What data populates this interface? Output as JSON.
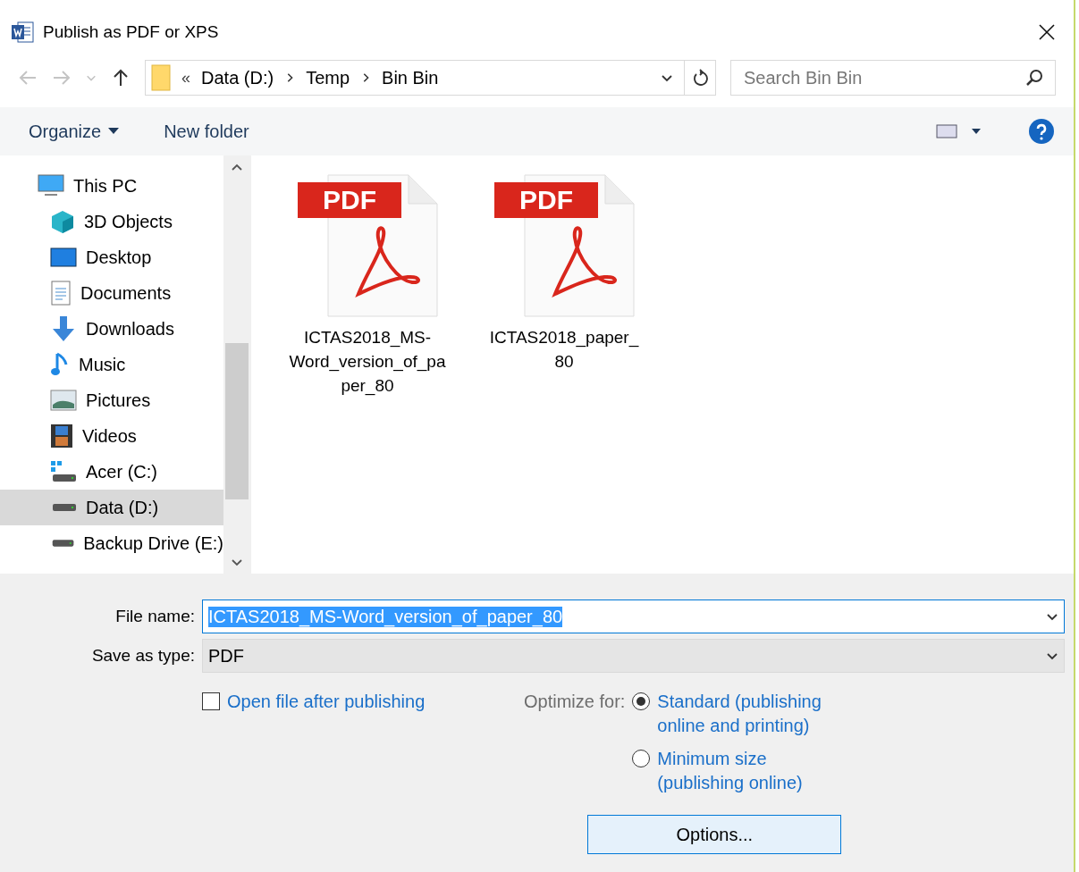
{
  "window": {
    "title": "Publish as PDF or XPS"
  },
  "address_bar": {
    "overflow": "«",
    "crumbs": [
      "Data (D:)",
      "Temp",
      "Bin Bin"
    ]
  },
  "search": {
    "placeholder": "Search Bin Bin"
  },
  "toolbar": {
    "organize": "Organize",
    "new_folder": "New folder"
  },
  "sidebar": {
    "items": [
      {
        "label": "This PC",
        "kind": "pc",
        "selected": false,
        "children": [
          {
            "label": "3D Objects",
            "kind": "cube",
            "selected": false
          },
          {
            "label": "Desktop",
            "kind": "desktop",
            "selected": false
          },
          {
            "label": "Documents",
            "kind": "documents",
            "selected": false
          },
          {
            "label": "Downloads",
            "kind": "downloads",
            "selected": false
          },
          {
            "label": "Music",
            "kind": "music",
            "selected": false
          },
          {
            "label": "Pictures",
            "kind": "pictures",
            "selected": false
          },
          {
            "label": "Videos",
            "kind": "videos",
            "selected": false
          },
          {
            "label": "Acer (C:)",
            "kind": "windrive",
            "selected": false
          },
          {
            "label": "Data (D:)",
            "kind": "drive",
            "selected": true
          },
          {
            "label": "Backup Drive (E:)",
            "kind": "drive",
            "selected": false
          }
        ]
      }
    ]
  },
  "files": [
    {
      "badge": "PDF",
      "name": "ICTAS2018_MS-Word_version_of_paper_80"
    },
    {
      "badge": "PDF",
      "name": "ICTAS2018_paper_80"
    }
  ],
  "form": {
    "file_name_label": "File name:",
    "file_name": "ICTAS2018_MS-Word_version_of_paper_80",
    "type_label": "Save as type:",
    "type": "PDF"
  },
  "open_after": {
    "label": "Open file after publishing",
    "checked": false
  },
  "optimize": {
    "label": "Optimize for:",
    "options": [
      {
        "label": "Standard (publishing online and printing)",
        "selected": true
      },
      {
        "label": "Minimum size (publishing online)",
        "selected": false
      }
    ]
  },
  "options_button": "Options..."
}
